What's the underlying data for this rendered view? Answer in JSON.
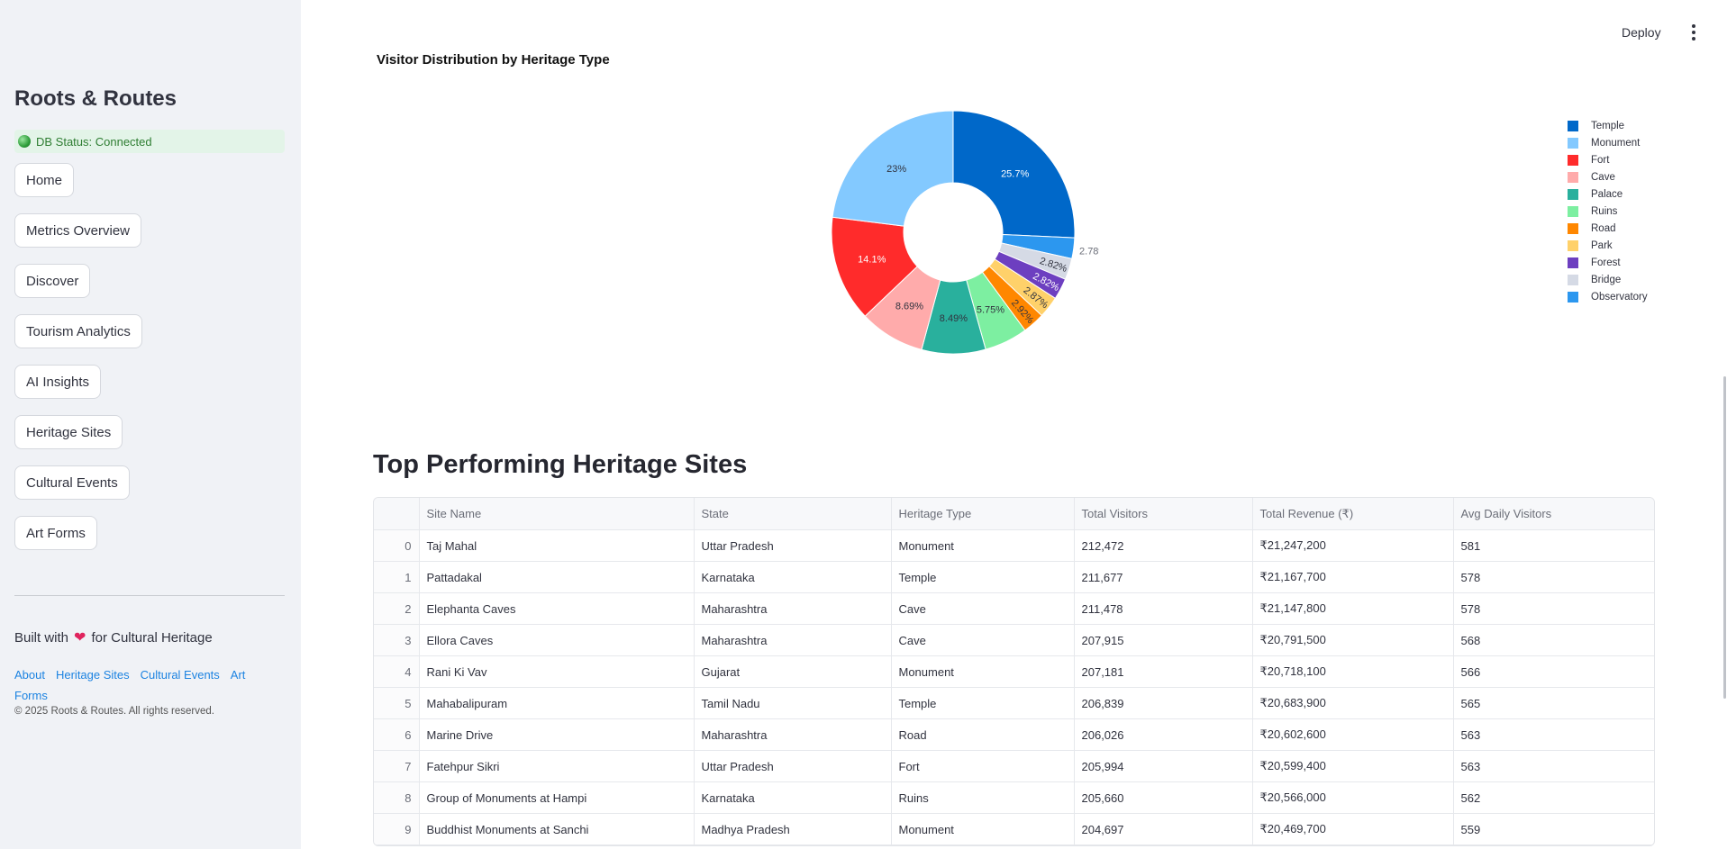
{
  "sidebar": {
    "title": "Roots & Routes",
    "status": "DB Status: Connected",
    "nav": [
      "Home",
      "Metrics Overview",
      "Discover",
      "Tourism Analytics",
      "AI Insights",
      "Heritage Sites",
      "Cultural Events",
      "Art Forms"
    ],
    "built_prefix": "Built with",
    "built_suffix": "for Cultural Heritage",
    "links": [
      "About",
      "Heritage Sites",
      "Cultural Events",
      "Art Forms"
    ],
    "copyright": "© 2025 Roots & Routes. All rights reserved."
  },
  "header": {
    "deploy_label": "Deploy"
  },
  "chart_data": {
    "type": "pie",
    "title": "Visitor Distribution by Heritage Type",
    "hole": true,
    "legend_position": "right",
    "slices": [
      {
        "label": "Temple",
        "value": 25.7,
        "text": "25.7%",
        "color": "#0068c9"
      },
      {
        "label": "Observatory",
        "value": 2.78,
        "text": "2.78%",
        "color": "#2c97ef"
      },
      {
        "label": "Bridge",
        "value": 2.82,
        "text": "2.82%",
        "color": "#d5dae5"
      },
      {
        "label": "Forest",
        "value": 2.82,
        "text": "2.82%",
        "color": "#6d3fc0"
      },
      {
        "label": "Park",
        "value": 2.87,
        "text": "2.87%",
        "color": "#ffd16a"
      },
      {
        "label": "Road",
        "value": 2.92,
        "text": "2.92%",
        "color": "#ff8700"
      },
      {
        "label": "Ruins",
        "value": 5.75,
        "text": "5.75%",
        "color": "#7defa1"
      },
      {
        "label": "Palace",
        "value": 8.49,
        "text": "8.49%",
        "color": "#29b09d"
      },
      {
        "label": "Cave",
        "value": 8.69,
        "text": "8.69%",
        "color": "#ffabab"
      },
      {
        "label": "Fort",
        "value": 14.1,
        "text": "14.1%",
        "color": "#ff2b2b"
      },
      {
        "label": "Monument",
        "value": 23,
        "text": "23%",
        "color": "#83c9ff"
      }
    ],
    "legend": [
      {
        "label": "Temple",
        "color": "#0068c9"
      },
      {
        "label": "Monument",
        "color": "#83c9ff"
      },
      {
        "label": "Fort",
        "color": "#ff2b2b"
      },
      {
        "label": "Cave",
        "color": "#ffabab"
      },
      {
        "label": "Palace",
        "color": "#29b09d"
      },
      {
        "label": "Ruins",
        "color": "#7defa1"
      },
      {
        "label": "Road",
        "color": "#ff8700"
      },
      {
        "label": "Park",
        "color": "#ffd16a"
      },
      {
        "label": "Forest",
        "color": "#6d3fc0"
      },
      {
        "label": "Bridge",
        "color": "#d5dae5"
      },
      {
        "label": "Observatory",
        "color": "#2c97ef"
      }
    ]
  },
  "table": {
    "title": "Top Performing Heritage Sites",
    "columns": [
      "",
      "Site Name",
      "State",
      "Heritage Type",
      "Total Visitors",
      "Total Revenue (₹)",
      "Avg Daily Visitors"
    ],
    "rows": [
      [
        "0",
        "Taj Mahal",
        "Uttar Pradesh",
        "Monument",
        "212,472",
        "₹21,247,200",
        "581"
      ],
      [
        "1",
        "Pattadakal",
        "Karnataka",
        "Temple",
        "211,677",
        "₹21,167,700",
        "578"
      ],
      [
        "2",
        "Elephanta Caves",
        "Maharashtra",
        "Cave",
        "211,478",
        "₹21,147,800",
        "578"
      ],
      [
        "3",
        "Ellora Caves",
        "Maharashtra",
        "Cave",
        "207,915",
        "₹20,791,500",
        "568"
      ],
      [
        "4",
        "Rani Ki Vav",
        "Gujarat",
        "Monument",
        "207,181",
        "₹20,718,100",
        "566"
      ],
      [
        "5",
        "Mahabalipuram",
        "Tamil Nadu",
        "Temple",
        "206,839",
        "₹20,683,900",
        "565"
      ],
      [
        "6",
        "Marine Drive",
        "Maharashtra",
        "Road",
        "206,026",
        "₹20,602,600",
        "563"
      ],
      [
        "7",
        "Fatehpur Sikri",
        "Uttar Pradesh",
        "Fort",
        "205,994",
        "₹20,599,400",
        "563"
      ],
      [
        "8",
        "Group of Monuments at Hampi",
        "Karnataka",
        "Ruins",
        "205,660",
        "₹20,566,000",
        "562"
      ],
      [
        "9",
        "Buddhist Monuments at Sanchi",
        "Madhya Pradesh",
        "Monument",
        "204,697",
        "₹20,469,700",
        "559"
      ]
    ]
  }
}
